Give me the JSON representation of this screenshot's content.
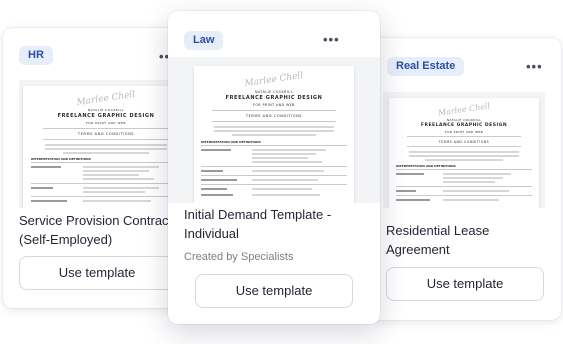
{
  "cards": [
    {
      "category": "HR",
      "title": "Service Provision Contract (Self-Employed)",
      "button_label": "Use template",
      "more_label": "•••"
    },
    {
      "category": "Law",
      "title": "Initial Demand Template - Individual",
      "subtitle": "Created by Specialists",
      "button_label": "Use template",
      "more_label": "•••"
    },
    {
      "category": "Real Estate",
      "title": "Residential Lease Agreement",
      "button_label": "Use template",
      "more_label": "•••"
    }
  ],
  "document_preview": {
    "logo_text": "Marlee Chell",
    "author": "NATALIE COCKRILL",
    "heading": "FREELANCE GRAPHIC DESIGN",
    "tagline": "FOR PRINT AND WEB",
    "section": "TERMS AND CONDITIONS",
    "sub_section": "INTERPRETATION AND DEFINITIONS"
  }
}
